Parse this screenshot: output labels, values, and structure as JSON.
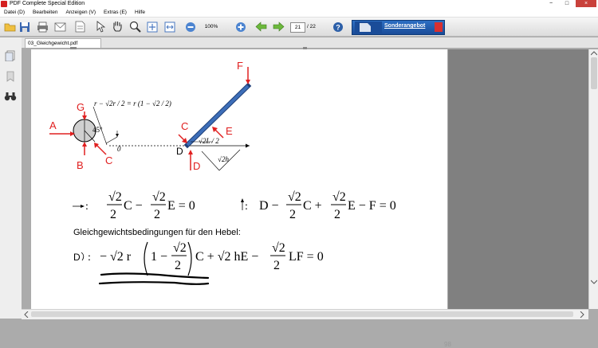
{
  "window": {
    "title": "PDF Complete Special Edition",
    "controls": [
      "−",
      "□",
      "×"
    ]
  },
  "menu": [
    "Datei (D)",
    "Bearbeiten",
    "Anzeigen (V)",
    "Extras (E)",
    "Hilfe"
  ],
  "toolbar": {
    "zoom": "100%",
    "page_current": "21",
    "page_total": "/ 22",
    "promo": "Sonderangebot"
  },
  "tab": {
    "label": "03_Gleichgewicht.pdf"
  },
  "page": {
    "number": "98",
    "heading": "Gleichgewichtsbedingungen für den Hebel:",
    "diagram": {
      "points": {
        "A": "A",
        "B": "B",
        "C1": "C",
        "C2": "C",
        "D": "D",
        "D2": "D",
        "E": "E",
        "F": "F",
        "G": "G"
      },
      "labels": {
        "angle": "45°",
        "zero": "0",
        "halfL": "√2L / 2",
        "h": "√2h"
      },
      "formula_top": "r − √2r / 2 = r (1 − √2 / 2)"
    },
    "equations": {
      "horizontal": {
        "symbol": "→:",
        "text": "√2/2 C − √2/2 E = 0"
      },
      "vertical": {
        "symbol": "↑:",
        "text": "D − √2/2 C + √2/2 E − F = 0"
      },
      "moment": {
        "symbol": "D↻:",
        "text": "− √2 r (1 − √2/2) C + √2 hE − √2/2 LF = 0"
      }
    }
  },
  "colors": {
    "annotation_red": "#e02020",
    "rod_blue": "#3d6eb8",
    "rod_outline": "#1e3f78"
  }
}
